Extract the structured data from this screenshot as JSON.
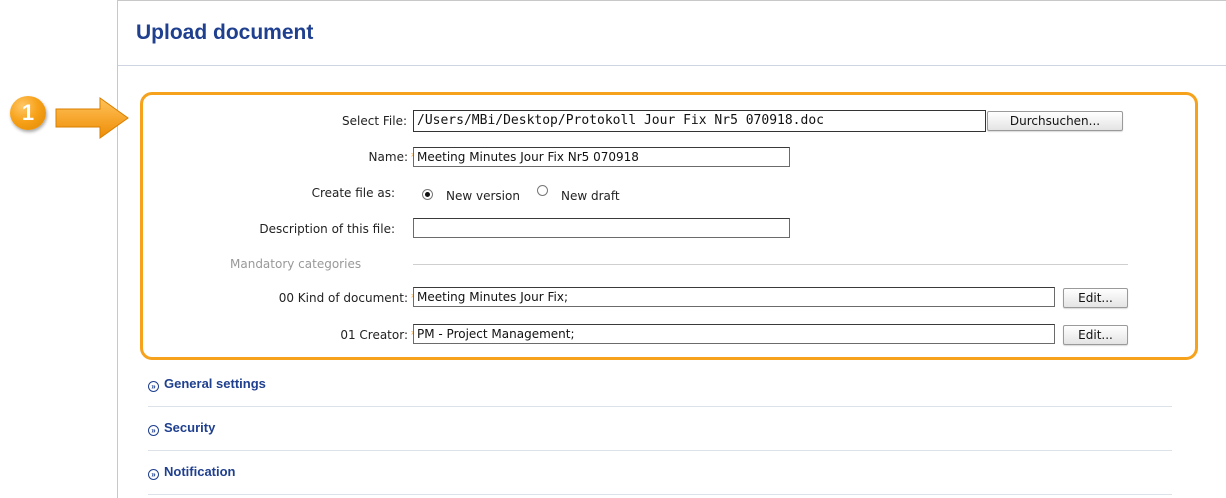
{
  "page": {
    "title": "Upload document"
  },
  "callout": {
    "number": "1"
  },
  "form": {
    "select_file": {
      "label": "Select File:",
      "value": "/Users/MBi/Desktop/Protokoll Jour Fix Nr5 070918.doc",
      "browse_label": "Durchsuchen..."
    },
    "name": {
      "label": "Name:",
      "required_mark": "*",
      "value": "Meeting Minutes Jour Fix Nr5 070918"
    },
    "create_as": {
      "label": "Create file as:",
      "options": [
        "New version",
        "New draft"
      ],
      "selected": "New version"
    },
    "description": {
      "label": "Description of this file:",
      "value": ""
    },
    "mandatory_categories": {
      "heading": "Mandatory categories"
    },
    "kind_of_document": {
      "label": "00 Kind of document:",
      "required_mark": "*",
      "value": "Meeting Minutes Jour Fix;",
      "edit_label": "Edit..."
    },
    "creator": {
      "label": "01 Creator:",
      "required_mark": "*",
      "value": "PM - Project Management;",
      "edit_label": "Edit..."
    }
  },
  "sections": [
    {
      "label": "General settings"
    },
    {
      "label": "Security"
    },
    {
      "label": "Notification"
    }
  ],
  "colors": {
    "title": "#1f3f8f",
    "highlight": "#f6a21c",
    "required": "#f39a1d"
  }
}
